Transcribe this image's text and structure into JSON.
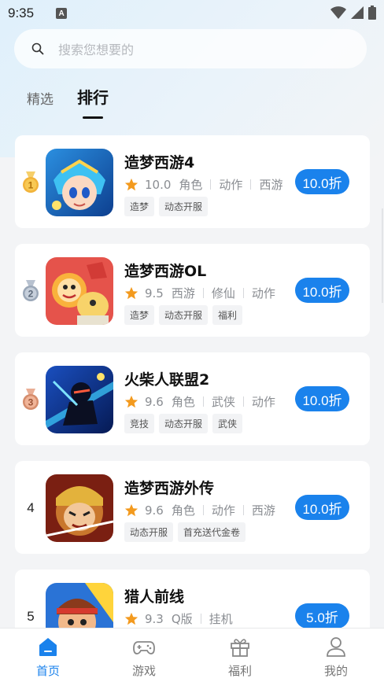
{
  "status_bar": {
    "time": "9:35",
    "notification_badge": "A"
  },
  "search": {
    "placeholder": "搜索您想要的"
  },
  "tabs": [
    {
      "label": "精选",
      "active": false
    },
    {
      "label": "排行",
      "active": true
    }
  ],
  "games": [
    {
      "rank": "1",
      "medal": "gold",
      "title": "造梦西游4",
      "score": "10.0",
      "categories": [
        "角色",
        "动作",
        "西游"
      ],
      "tags": [
        "造梦",
        "动态开服"
      ],
      "discount": "10.0折"
    },
    {
      "rank": "2",
      "medal": "silver",
      "title": "造梦西游OL",
      "score": "9.5",
      "categories": [
        "西游",
        "修仙",
        "动作"
      ],
      "tags": [
        "造梦",
        "动态开服",
        "福利"
      ],
      "discount": "10.0折"
    },
    {
      "rank": "3",
      "medal": "bronze",
      "title": "火柴人联盟2",
      "score": "9.6",
      "categories": [
        "角色",
        "武侠",
        "动作"
      ],
      "tags": [
        "竞技",
        "动态开服",
        "武侠"
      ],
      "discount": "10.0折"
    },
    {
      "rank": "4",
      "medal": "",
      "title": "造梦西游外传",
      "score": "9.6",
      "categories": [
        "角色",
        "动作",
        "西游"
      ],
      "tags": [
        "动态开服",
        "首充送代金卷"
      ],
      "discount": "10.0折"
    },
    {
      "rank": "5",
      "medal": "",
      "title": "猎人前线",
      "score": "9.3",
      "categories": [
        "Q版",
        "挂机"
      ],
      "tags": [],
      "discount": "5.0折"
    }
  ],
  "bottom_nav": [
    {
      "label": "首页",
      "icon": "home-icon",
      "active": true
    },
    {
      "label": "游戏",
      "icon": "gamepad-icon",
      "active": false
    },
    {
      "label": "福利",
      "icon": "gift-icon",
      "active": false
    },
    {
      "label": "我的",
      "icon": "user-icon",
      "active": false
    }
  ],
  "colors": {
    "accent": "#1a82ec",
    "star": "#f39a1e",
    "gold": "#f2b33a",
    "silver": "#9aa7b8",
    "bronze": "#d58c6c"
  }
}
